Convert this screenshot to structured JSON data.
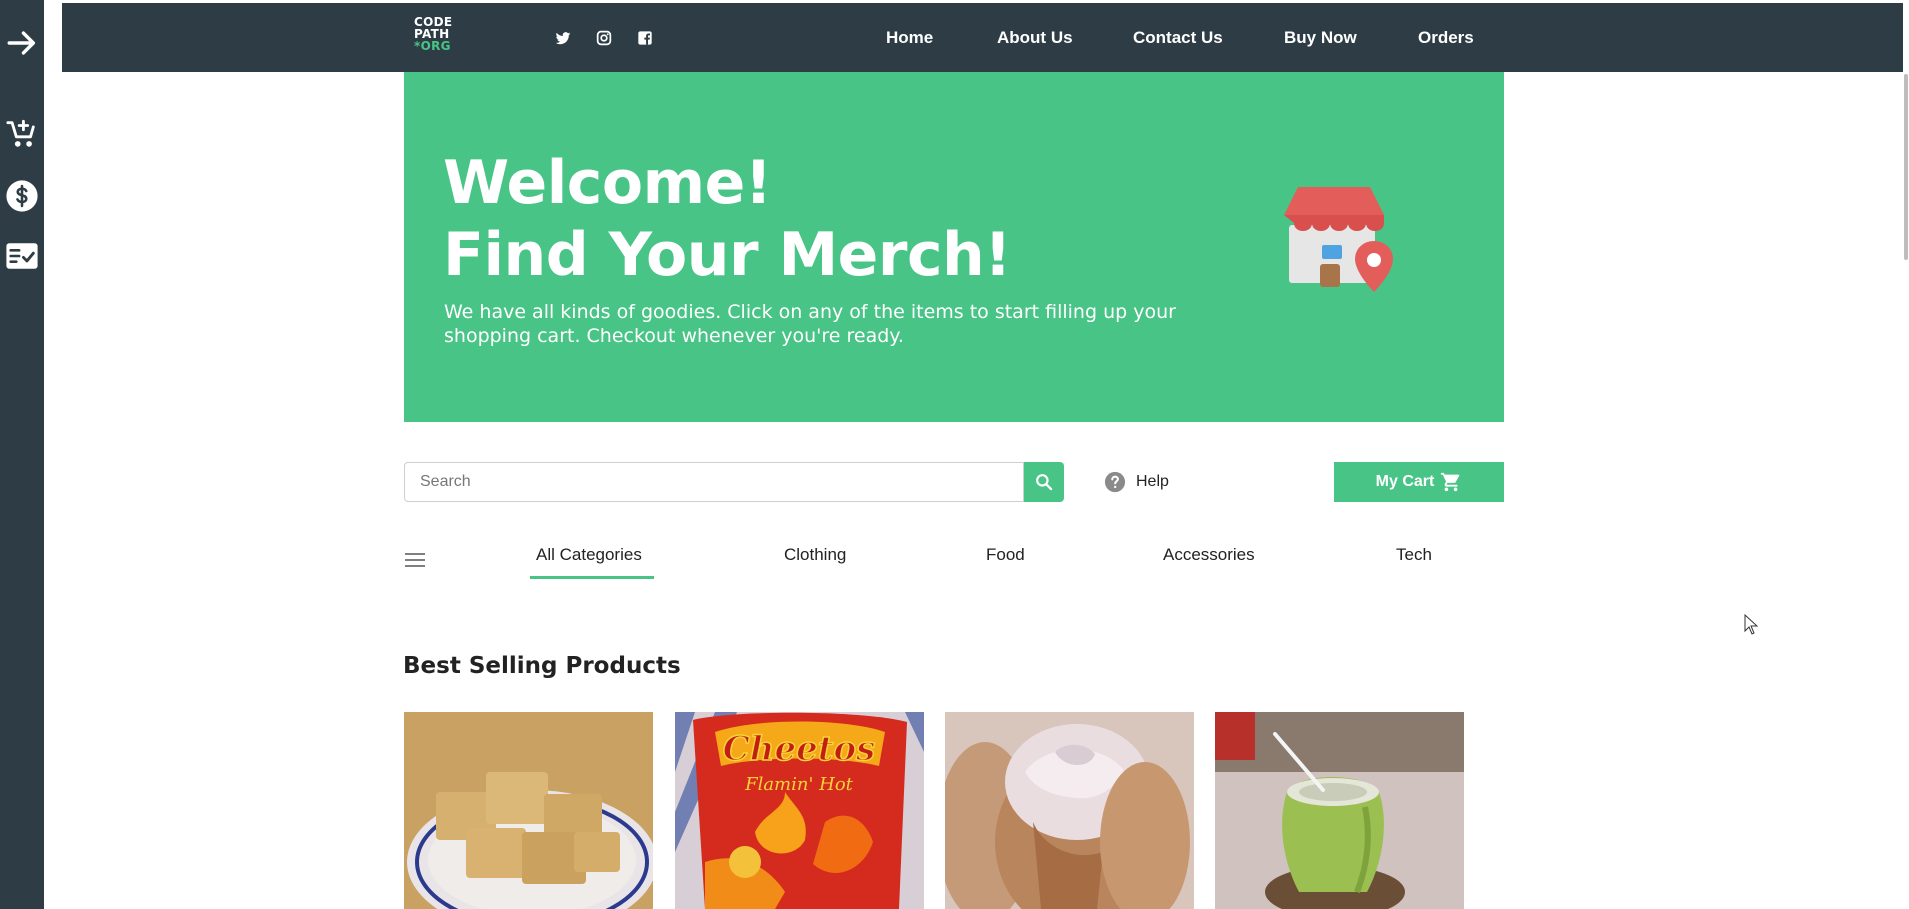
{
  "brand": {
    "logo_line1": "CODE",
    "logo_line2": "PATH",
    "logo_line3": "*ORG",
    "accent_color": "#48c486",
    "dark_color": "#2e3d45"
  },
  "sidebar": {
    "items": [
      {
        "icon": "arrow-right-icon"
      },
      {
        "icon": "add-to-cart-icon"
      },
      {
        "icon": "dollar-icon"
      },
      {
        "icon": "checklist-icon"
      }
    ]
  },
  "social": [
    "twitter-icon",
    "instagram-icon",
    "facebook-icon"
  ],
  "nav": {
    "links": [
      "Home",
      "About Us",
      "Contact Us",
      "Buy Now",
      "Orders"
    ]
  },
  "hero": {
    "title_line1": "Welcome!",
    "title_line2": "Find Your Merch!",
    "subtitle": "We have all kinds of goodies. Click on any of the items to start filling up your shopping cart. Checkout whenever you're ready."
  },
  "search": {
    "placeholder": "Search",
    "value": ""
  },
  "help": {
    "label": "Help"
  },
  "cart": {
    "label": "My Cart"
  },
  "categories": {
    "items": [
      "All Categories",
      "Clothing",
      "Food",
      "Accessories",
      "Tech"
    ],
    "selected": "All Categories"
  },
  "best_selling": {
    "title": "Best Selling Products",
    "products": [
      {
        "image": "rice-krispie-treats"
      },
      {
        "image": "cheetos-flamin-hot"
      },
      {
        "image": "cinnamon-roll"
      },
      {
        "image": "coconut-drink"
      }
    ]
  }
}
